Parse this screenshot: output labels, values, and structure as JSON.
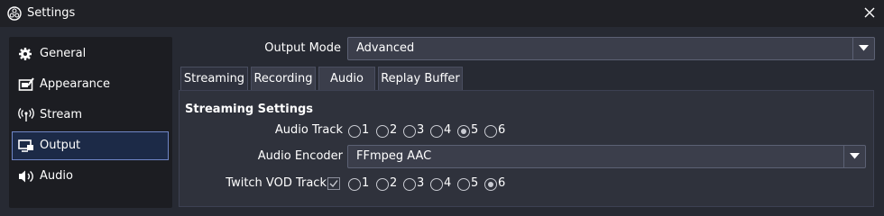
{
  "window": {
    "title": "Settings"
  },
  "sidebar": {
    "items": [
      {
        "label": "General",
        "icon": "gear-icon"
      },
      {
        "label": "Appearance",
        "icon": "appearance-icon"
      },
      {
        "label": "Stream",
        "icon": "antenna-icon"
      },
      {
        "label": "Output",
        "icon": "output-icon",
        "selected": true
      },
      {
        "label": "Audio",
        "icon": "speaker-icon"
      }
    ]
  },
  "output_mode": {
    "label": "Output Mode",
    "value": "Advanced"
  },
  "tabs": [
    {
      "label": "Streaming",
      "active": true
    },
    {
      "label": "Recording"
    },
    {
      "label": "Audio"
    },
    {
      "label": "Replay Buffer"
    }
  ],
  "streaming": {
    "section_title": "Streaming Settings",
    "audio_track": {
      "label": "Audio Track",
      "options": [
        "1",
        "2",
        "3",
        "4",
        "5",
        "6"
      ],
      "selected": "5"
    },
    "audio_encoder": {
      "label": "Audio Encoder",
      "value": "FFmpeg AAC"
    },
    "twitch_vod_track": {
      "label": "Twitch VOD Track",
      "checked": true,
      "options": [
        "1",
        "2",
        "3",
        "4",
        "5",
        "6"
      ],
      "selected": "6"
    }
  },
  "colors": {
    "background": "#272a33",
    "accent_border": "#6f86c7",
    "selected_bg": "#1c2a47"
  }
}
